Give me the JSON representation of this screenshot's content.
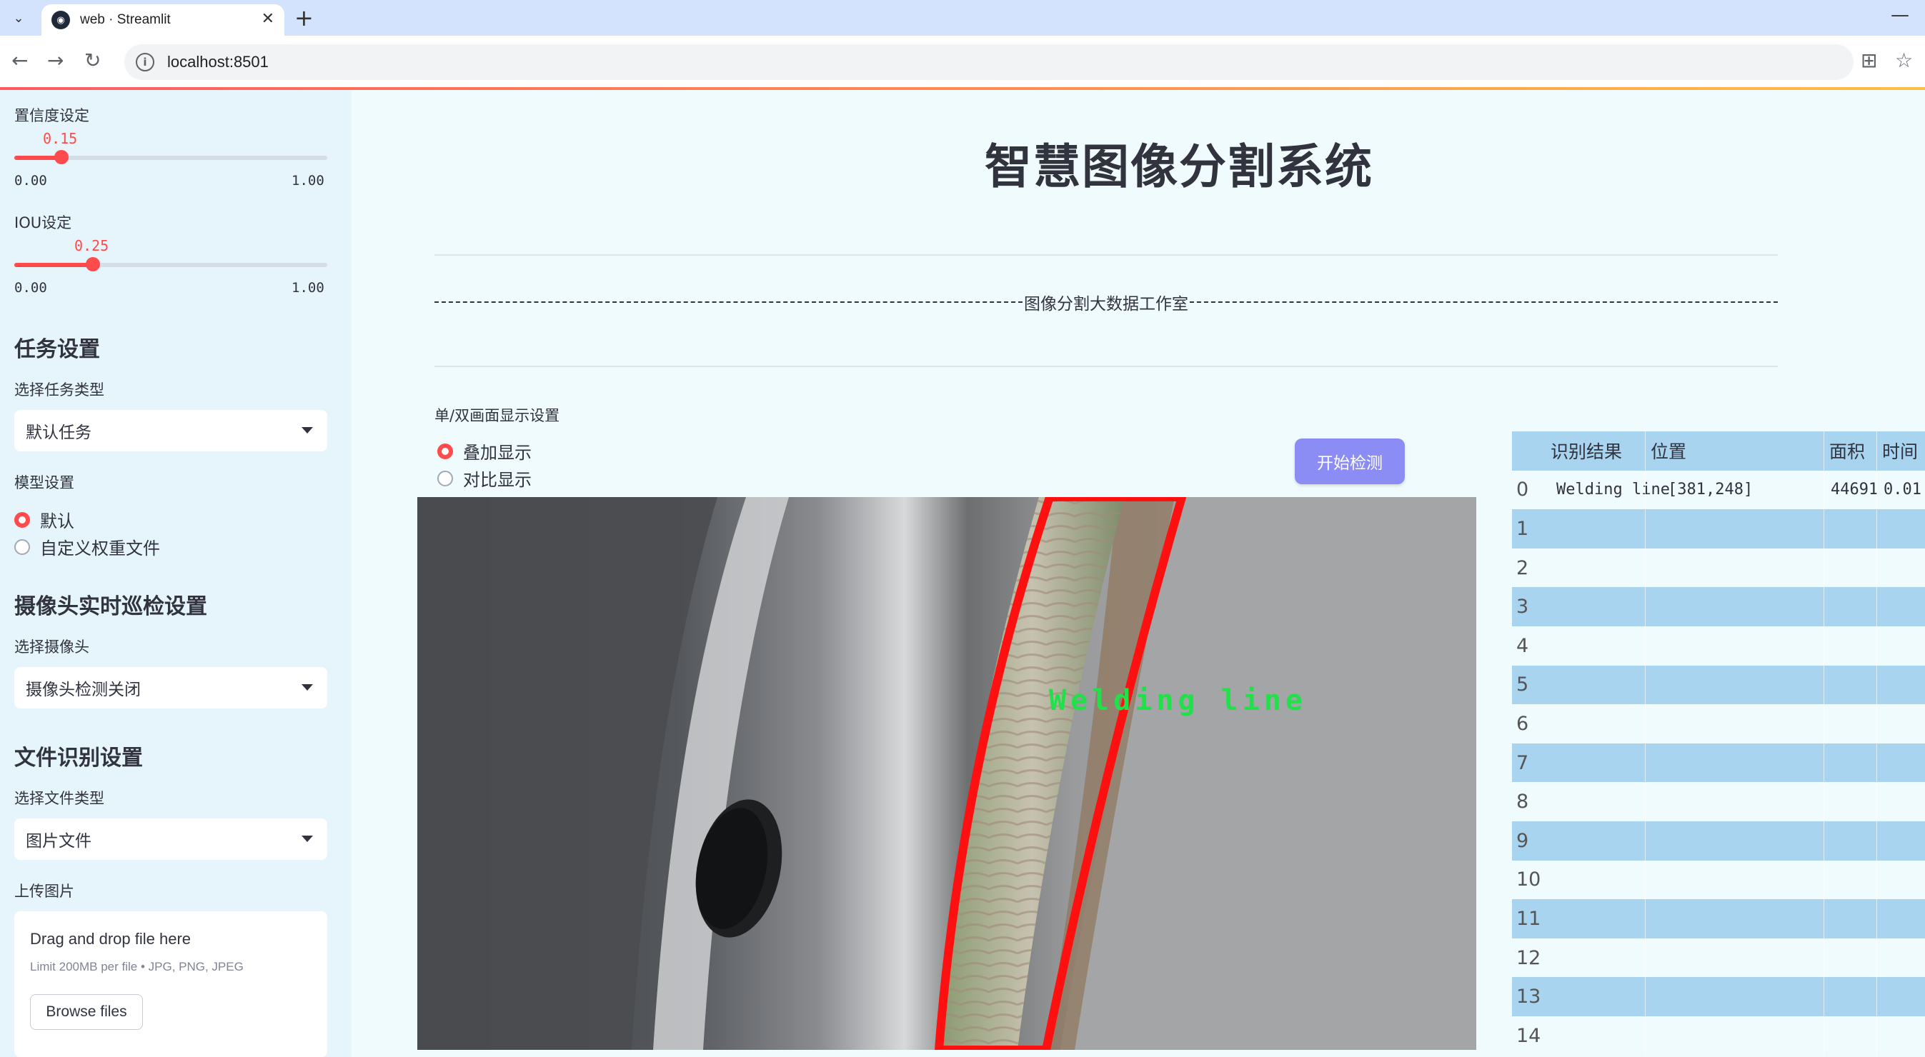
{
  "browser": {
    "tab_title": "web · Streamlit",
    "url": "localhost:8501"
  },
  "sidebar": {
    "confidence": {
      "label": "置信度设定",
      "value": "0.15",
      "value_num": 0.15,
      "min": "0.00",
      "max": "1.00"
    },
    "iou": {
      "label": "IOU设定",
      "value": "0.25",
      "value_num": 0.25,
      "min": "0.00",
      "max": "1.00"
    },
    "task_heading": "任务设置",
    "task_type_label": "选择任务类型",
    "task_type_value": "默认任务",
    "model_label": "模型设置",
    "model_options": [
      "默认",
      "自定义权重文件"
    ],
    "camera_heading": "摄像头实时巡检设置",
    "camera_label": "选择摄像头",
    "camera_value": "摄像头检测关闭",
    "file_heading": "文件识别设置",
    "file_type_label": "选择文件类型",
    "file_type_value": "图片文件",
    "upload_label": "上传图片",
    "upload_title": "Drag and drop file here",
    "upload_limit": "Limit 200MB per file • JPG, PNG, JPEG",
    "browse_label": "Browse files"
  },
  "main": {
    "title": "智慧图像分割系统",
    "studio": "图像分割大数据工作室",
    "mode_label": "单/双画面显示设置",
    "mode_options": [
      "叠加显示",
      "对比显示"
    ],
    "start_button": "开始检测",
    "detection_label": "Welding line"
  },
  "table": {
    "columns": [
      "识别结果",
      "位置",
      "面积",
      "时间"
    ],
    "rows": [
      {
        "index": "0",
        "result": "Welding line",
        "position": "[381,248]",
        "area": "44691",
        "time": "0.01"
      },
      {
        "index": "1"
      },
      {
        "index": "2"
      },
      {
        "index": "3"
      },
      {
        "index": "4"
      },
      {
        "index": "5"
      },
      {
        "index": "6"
      },
      {
        "index": "7"
      },
      {
        "index": "8"
      },
      {
        "index": "9"
      },
      {
        "index": "10"
      },
      {
        "index": "11"
      },
      {
        "index": "12"
      },
      {
        "index": "13"
      },
      {
        "index": "14"
      }
    ]
  },
  "colors": {
    "accent": "#ff4b4b",
    "start_button": "#8c8cf5",
    "table_stripe": "#a8d4f0",
    "sidebar_bg": "#e6f4fb"
  }
}
